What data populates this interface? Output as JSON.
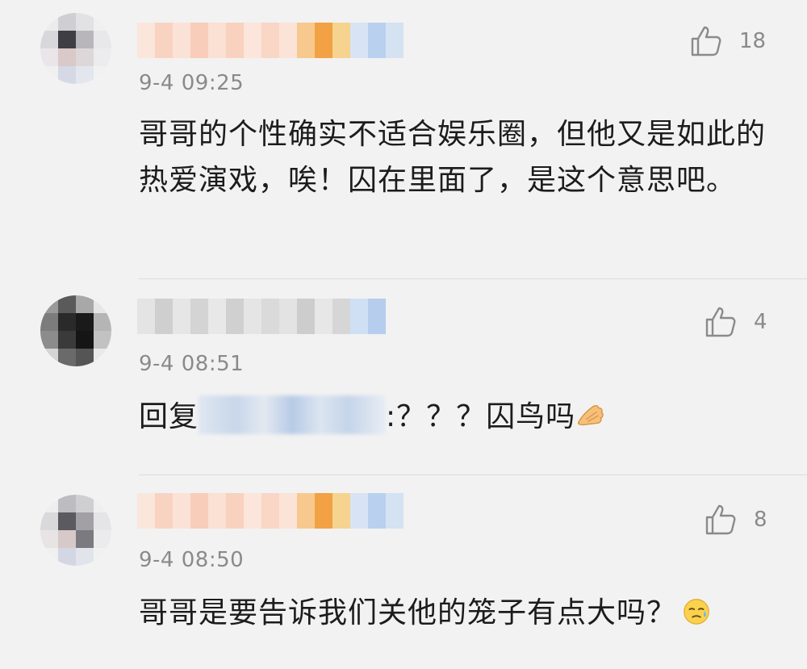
{
  "comments": [
    {
      "time": "9-4 09:25",
      "likes": "18",
      "text": "哥哥的个性确实不适合娱乐圈，但他又是如此的热爱演戏，唉！囚在里面了，是这个意思吧。"
    },
    {
      "time": "9-4 08:51",
      "likes": "4",
      "reply_prefix": "回复",
      "reply_suffix": ":？？？囚鸟吗"
    },
    {
      "time": "9-4 08:50",
      "likes": "8",
      "text": "哥哥是要告诉我们关他的笼子有点大吗？"
    }
  ],
  "icons": {
    "like": "thumbs-up-icon",
    "emoji_hands": "pressed-hands-emoji",
    "emoji_sweat": "sweat-face-emoji"
  },
  "colors": {
    "background": "#f2f2f2",
    "text": "#1c1c1c",
    "meta": "#8a8a8a"
  }
}
